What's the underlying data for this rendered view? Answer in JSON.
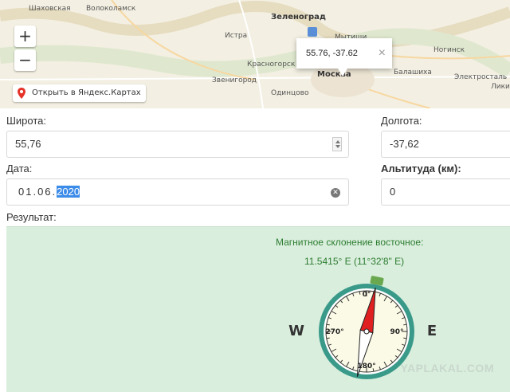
{
  "map": {
    "places": {
      "shakhovskaya": "Шаховская",
      "volokolamsk": "Волоколамск",
      "zelenograd": "Зеленоград",
      "istra": "Истра",
      "mytishchi": "Мытищи",
      "krasnogorsk": "Красногорск",
      "zvenigorod": "Звенигород",
      "moscow": "Москва",
      "balashikha": "Балашиха",
      "odintsovo": "Одинцово",
      "noginsk": "Ногинск",
      "elektrostal": "Электросталь",
      "likino": "Лики"
    },
    "zoom_in": "+",
    "zoom_out": "−",
    "yandex_link": "Открыть в Яндекс.Картах",
    "balloon_text": "55.76, -37.62",
    "balloon_close": "×"
  },
  "form": {
    "latitude_label": "Широта:",
    "latitude_value": "55,76",
    "longitude_label": "Долгота:",
    "longitude_value": "-37,62",
    "date_label": "Дата:",
    "date_day_month": "01.06.",
    "date_year": "2020",
    "altitude_label": "Альтитуда (км):",
    "altitude_value": "0"
  },
  "result": {
    "label": "Результат:",
    "declination_title": "Магнитное склонение восточное:",
    "declination_value": "11.5415° E (11°32'8\" E)",
    "compass": {
      "west": "W",
      "east": "E",
      "deg0": "0°",
      "deg90": "90°",
      "deg180": "180°",
      "deg270": "270°",
      "declination_deg": 11.5415
    },
    "watermark": "YAPLAKAL.COM"
  },
  "colors": {
    "result_bg": "#d9eedd",
    "accent_green": "#2e7d32",
    "compass_ring": "#3a9a8a",
    "needle_red": "#e02020",
    "highlight": "#3b8be8"
  }
}
